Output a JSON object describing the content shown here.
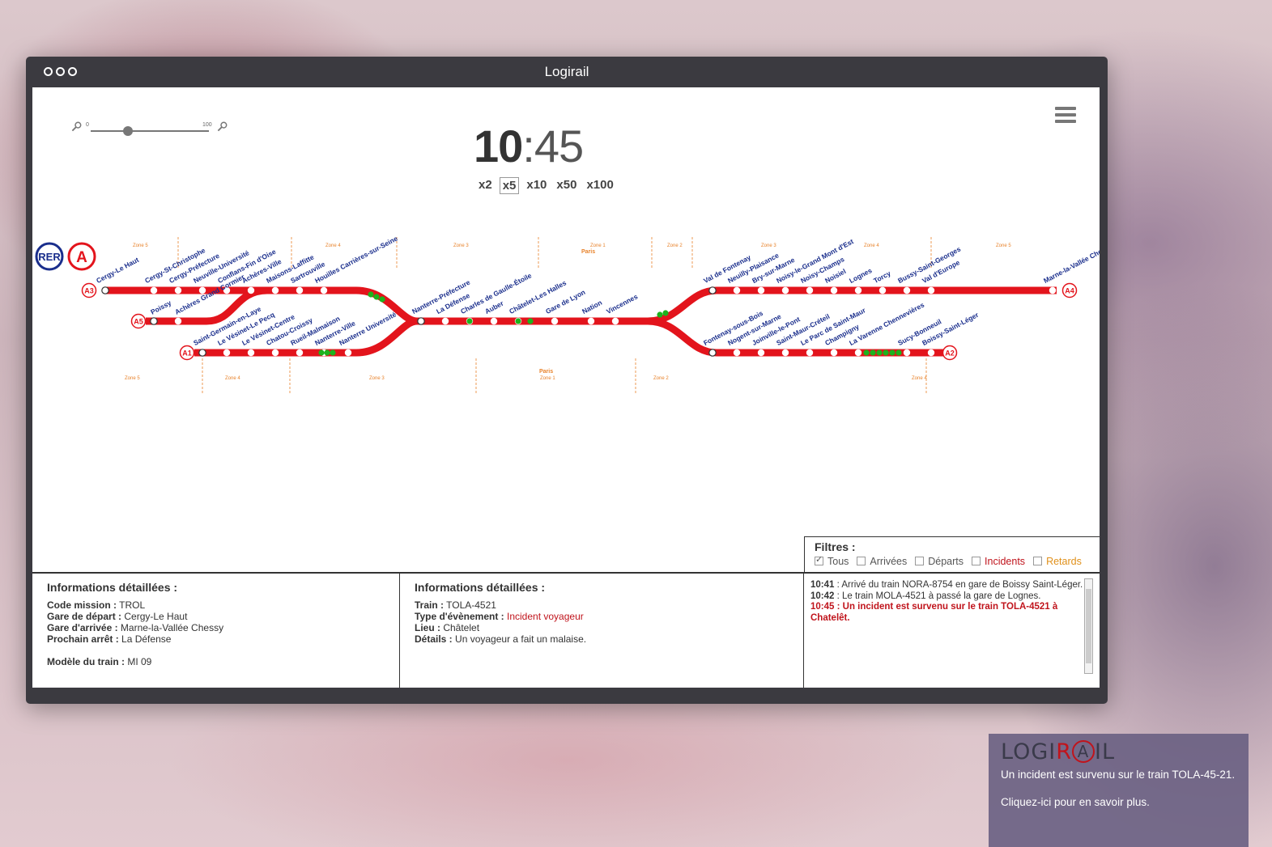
{
  "window": {
    "title": "Logirail"
  },
  "zoom": {
    "min": "0",
    "max": "100"
  },
  "clock": {
    "hours": "10",
    "minutes": ":45"
  },
  "speeds": [
    "x2",
    "x5",
    "x10",
    "x50",
    "x100"
  ],
  "selected_speed": "x5",
  "map": {
    "rer_label": "RER",
    "line_label": "A",
    "branches": {
      "a1": "A1",
      "a2": "A2",
      "a3": "A3",
      "a4": "A4",
      "a5": "A5"
    },
    "zones_top": [
      "Zone 5",
      "Zone 4",
      "Zone 3",
      "Zone 1",
      "Zone 2",
      "Zone 3",
      "Zone 4",
      "Zone 5"
    ],
    "zones_bottom": [
      "Zone 5",
      "Zone 4",
      "Zone 3",
      "Zone 1",
      "Zone 2",
      "Zone 4"
    ],
    "paris_top": "Paris",
    "paris_bottom": "Paris",
    "stations_a3": [
      "Cergy-Le Haut",
      "Cergy-St-Christophe",
      "Cergy-Préfecture",
      "Neuville-Université",
      "Conflans-Fin d'Oise",
      "Achères-Ville",
      "Maisons-Laffitte",
      "Sartrouville",
      "Houilles Carrières-sur-Seine"
    ],
    "stations_a5": [
      "Poissy",
      "Achères Grand Cormier"
    ],
    "stations_a1": [
      "Saint-Germain-en-Laye",
      "Le Vésinet-Le Pecq",
      "Le Vésinet-Centre",
      "Chatou-Croissy",
      "Rueil-Malmaison",
      "Nanterre-Ville",
      "Nanterre Université"
    ],
    "stations_central": [
      "Nanterre-Préfecture",
      "La Défense",
      "Charles de Gaulle-Étoile",
      "Auber",
      "Châtelet-Les Halles",
      "Gare de Lyon",
      "Nation",
      "Vincennes"
    ],
    "stations_a4": [
      "Val de Fontenay",
      "Neuilly-Plaisance",
      "Bry-sur-Marne",
      "Noisy-le-Grand Mont d'Est",
      "Noisy-Champs",
      "Noisiel",
      "Lognes",
      "Torcy",
      "Bussy-Saint-Georges",
      "Val d'Europe",
      "Marne-la-Vallée Chessy"
    ],
    "stations_a2": [
      "Fontenay-sous-Bois",
      "Nogent-sur-Marne",
      "Joinville-le-Pont",
      "Saint-Maur-Créteil",
      "Le Parc de Saint-Maur",
      "Champigny",
      "La Varenne Chennevières",
      "Sucy-Bonneuil",
      "Boissy-Saint-Léger"
    ],
    "colors": {
      "line": "#e3141c",
      "station": "#ffffff",
      "train": "#1db31d",
      "label": "#1a2e8c",
      "zone": "#e8822a"
    }
  },
  "filters": {
    "title": "Filtres :",
    "items": [
      {
        "label": "Tous",
        "checked": true,
        "color": "#555555"
      },
      {
        "label": "Arrivées",
        "checked": false,
        "color": "#555555"
      },
      {
        "label": "Départs",
        "checked": false,
        "color": "#555555"
      },
      {
        "label": "Incidents",
        "checked": false,
        "color": "#c0141c"
      },
      {
        "label": "Retards",
        "checked": false,
        "color": "#e0901a"
      }
    ]
  },
  "details_train": {
    "title": "Informations détaillées :",
    "rows": [
      {
        "k": "Code mission :",
        "v": " TROL"
      },
      {
        "k": "Gare de départ :",
        "v": " Cergy-Le Haut"
      },
      {
        "k": "Gare d'arrivée :",
        "v": " Marne-la-Vallée Chessy"
      },
      {
        "k": "Prochain arrêt :",
        "v": " La Défense"
      }
    ],
    "model_k": "Modèle du train :",
    "model_v": " MI 09"
  },
  "details_event": {
    "title": "Informations détaillées :",
    "train_k": "Train :",
    "train_v": " TOLA-4521",
    "type_k": "Type d'évènement :",
    "type_v": " Incident voyageur",
    "place_k": "Lieu :",
    "place_v": " Châtelet",
    "details_k": "Détails :",
    "details_v": " Un voyageur a fait un malaise."
  },
  "log": [
    {
      "time": "10:41",
      "text": " : Arrivé du train NORA-8754 en gare de Boissy Saint-Léger.",
      "incident": false
    },
    {
      "time": "10:42",
      "text": " : Le train MOLA-4521 à passé la gare de Lognes.",
      "incident": false
    },
    {
      "time": "10:45",
      "text": " : Un incident est survenu sur le train TOLA-4521 à Chatelêt.",
      "incident": true
    }
  ],
  "notification": {
    "logo": "LOGIRAIL",
    "message": "Un incident est survenu sur le train TOLA-45-21.",
    "cta": "Cliquez-ici pour en savoir plus."
  }
}
